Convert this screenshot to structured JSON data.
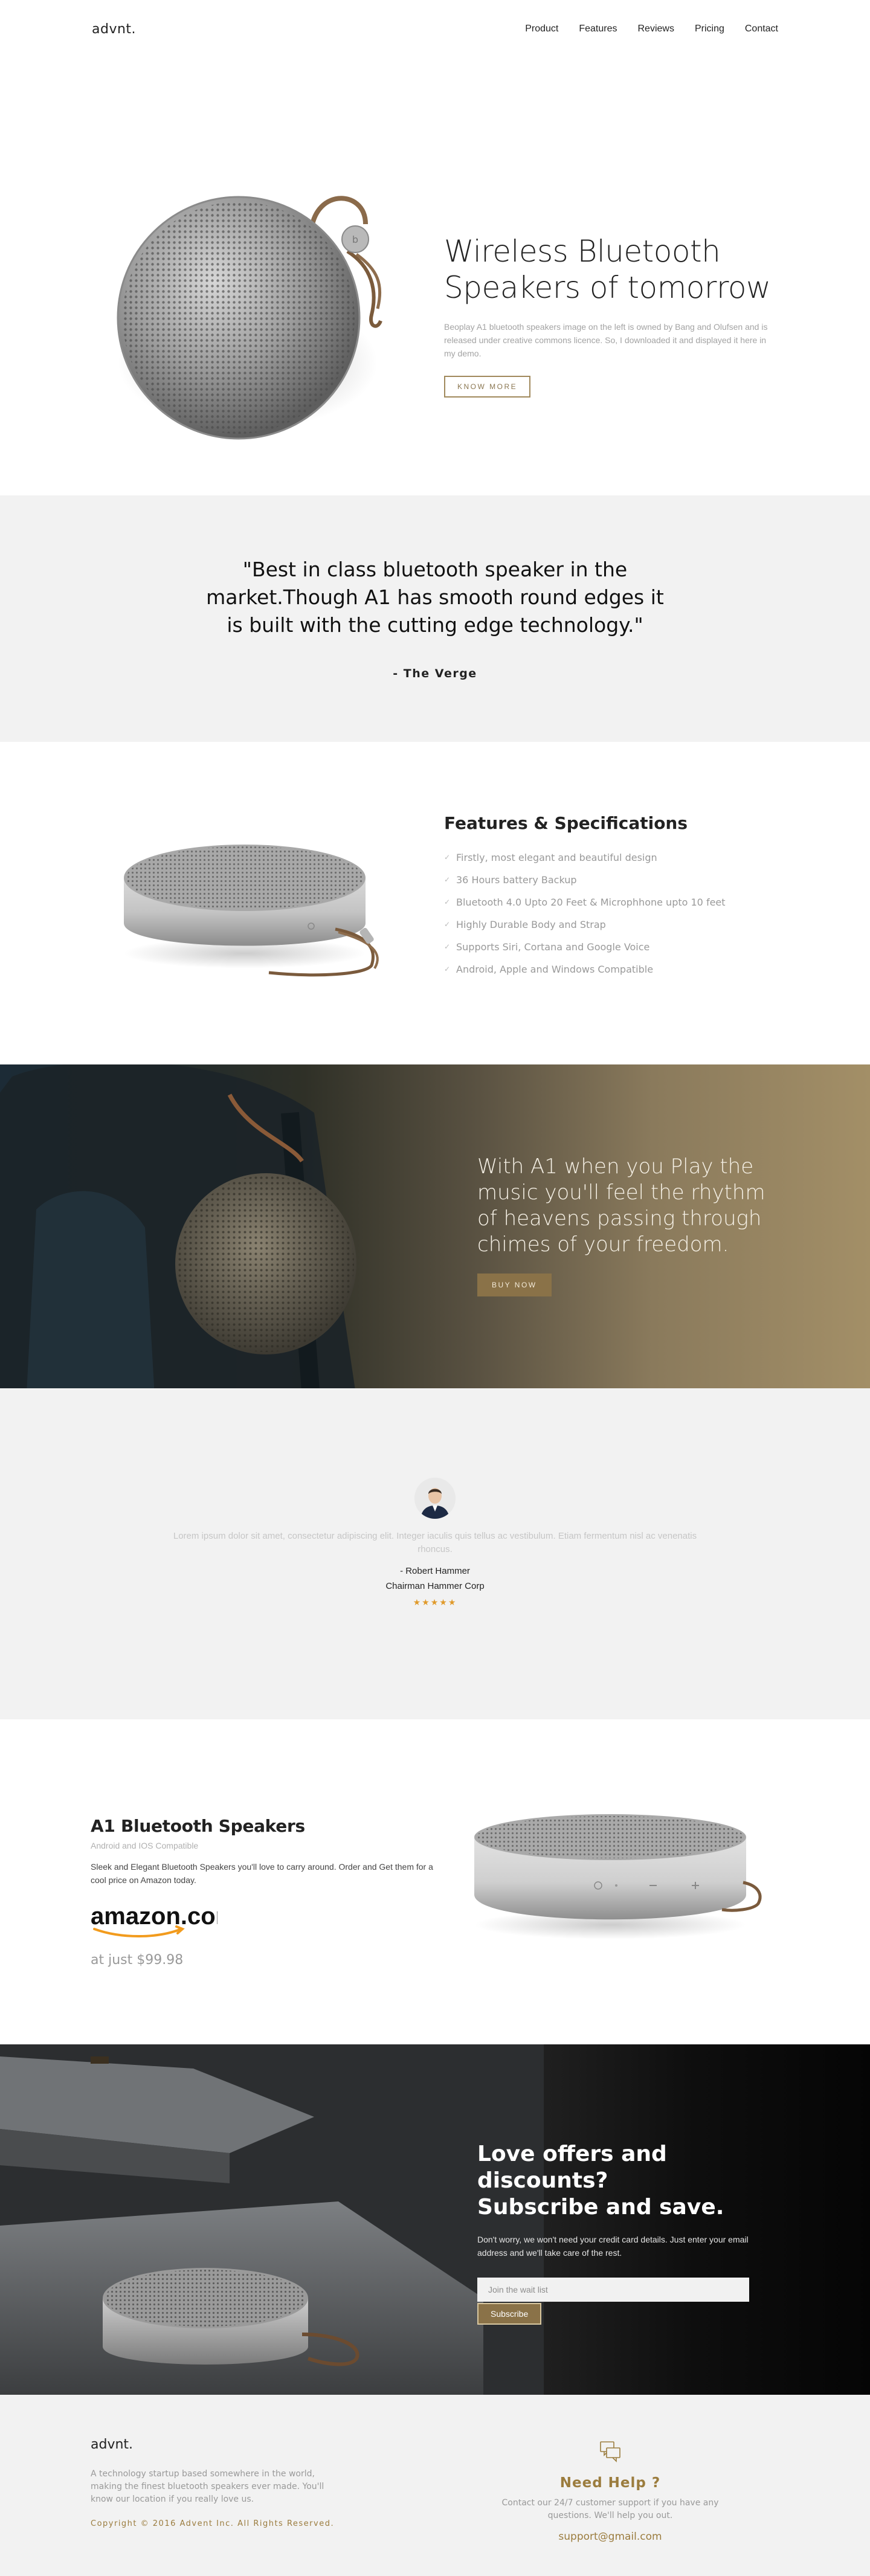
{
  "nav": {
    "logo": "advnt.",
    "links": [
      "Product",
      "Features",
      "Reviews",
      "Pricing",
      "Contact"
    ]
  },
  "hero": {
    "title_line1": "Wireless Bluetooth",
    "title_line2": "Speakers of tomorrow",
    "description": "Beoplay A1 bluetooth speakers image on the left is owned by Bang and Olufsen and is released under creative commons licence. So, I downloaded it and displayed it here in my demo.",
    "cta": "KNOW MORE"
  },
  "quote": {
    "text": "\"Best in class bluetooth speaker in the market.Though A1 has smooth round edges it is built with the cutting edge technology.\"",
    "source": "- The Verge"
  },
  "features": {
    "title": "Features & Specifications",
    "items": [
      "Firstly, most elegant and beautiful design",
      "36 Hours battery Backup",
      "Bluetooth 4.0 Upto 20 Feet & Microphhone upto 10 feet",
      "Highly Durable Body and Strap",
      "Supports Siri, Cortana and Google Voice",
      "Android, Apple and Windows Compatible"
    ],
    "bullet": "✓"
  },
  "banner": {
    "text": "With A1 when you Play the music you'll feel the rhythm of heavens passing through chimes of your freedom.",
    "cta": "BUY NOW"
  },
  "testimonial": {
    "text": "Lorem ipsum dolor sit amet, consectetur adipiscing elit. Integer iaculis quis tellus ac vestibulum. Etiam fermentum nisl ac venenatis rhoncus.",
    "name": "- Robert Hammer",
    "role": "Chairman Hammer Corp",
    "rating": 5,
    "stars": "★★★★★"
  },
  "product": {
    "title": "A1 Bluetooth Speakers",
    "subtitle": "Android and IOS Compatible",
    "description": "Sleek and Elegant Bluetooth Speakers you'll love to carry around. Order and Get them for a cool price on Amazon today.",
    "store_logo": "amazon.com",
    "price": "at just $99.98"
  },
  "subscribe": {
    "title_line1": "Love offers and discounts?",
    "title_line2": "Subscribe and save.",
    "description": "Don't worry, we won't need your credit card details. Just enter your email address and we'll take care of the rest.",
    "input_placeholder": "Join the wait list",
    "button": "Subscribe"
  },
  "footer": {
    "logo": "advnt.",
    "description": "A technology startup based somewhere in the world, making the finest bluetooth speakers ever made. You'll know our location if you really love us.",
    "copyright": "Copyright © 2016 Advent Inc. All Rights Reserved.",
    "help_title": "Need Help ?",
    "help_description": "Contact our 24/7 customer support if you have any questions. We'll help you out.",
    "help_email": "support@gmail.com"
  },
  "colors": {
    "accent": "#9b7c3e",
    "button_fill": "#8a7248",
    "section_bg": "#f2f2f2",
    "star": "#e09a2a"
  }
}
